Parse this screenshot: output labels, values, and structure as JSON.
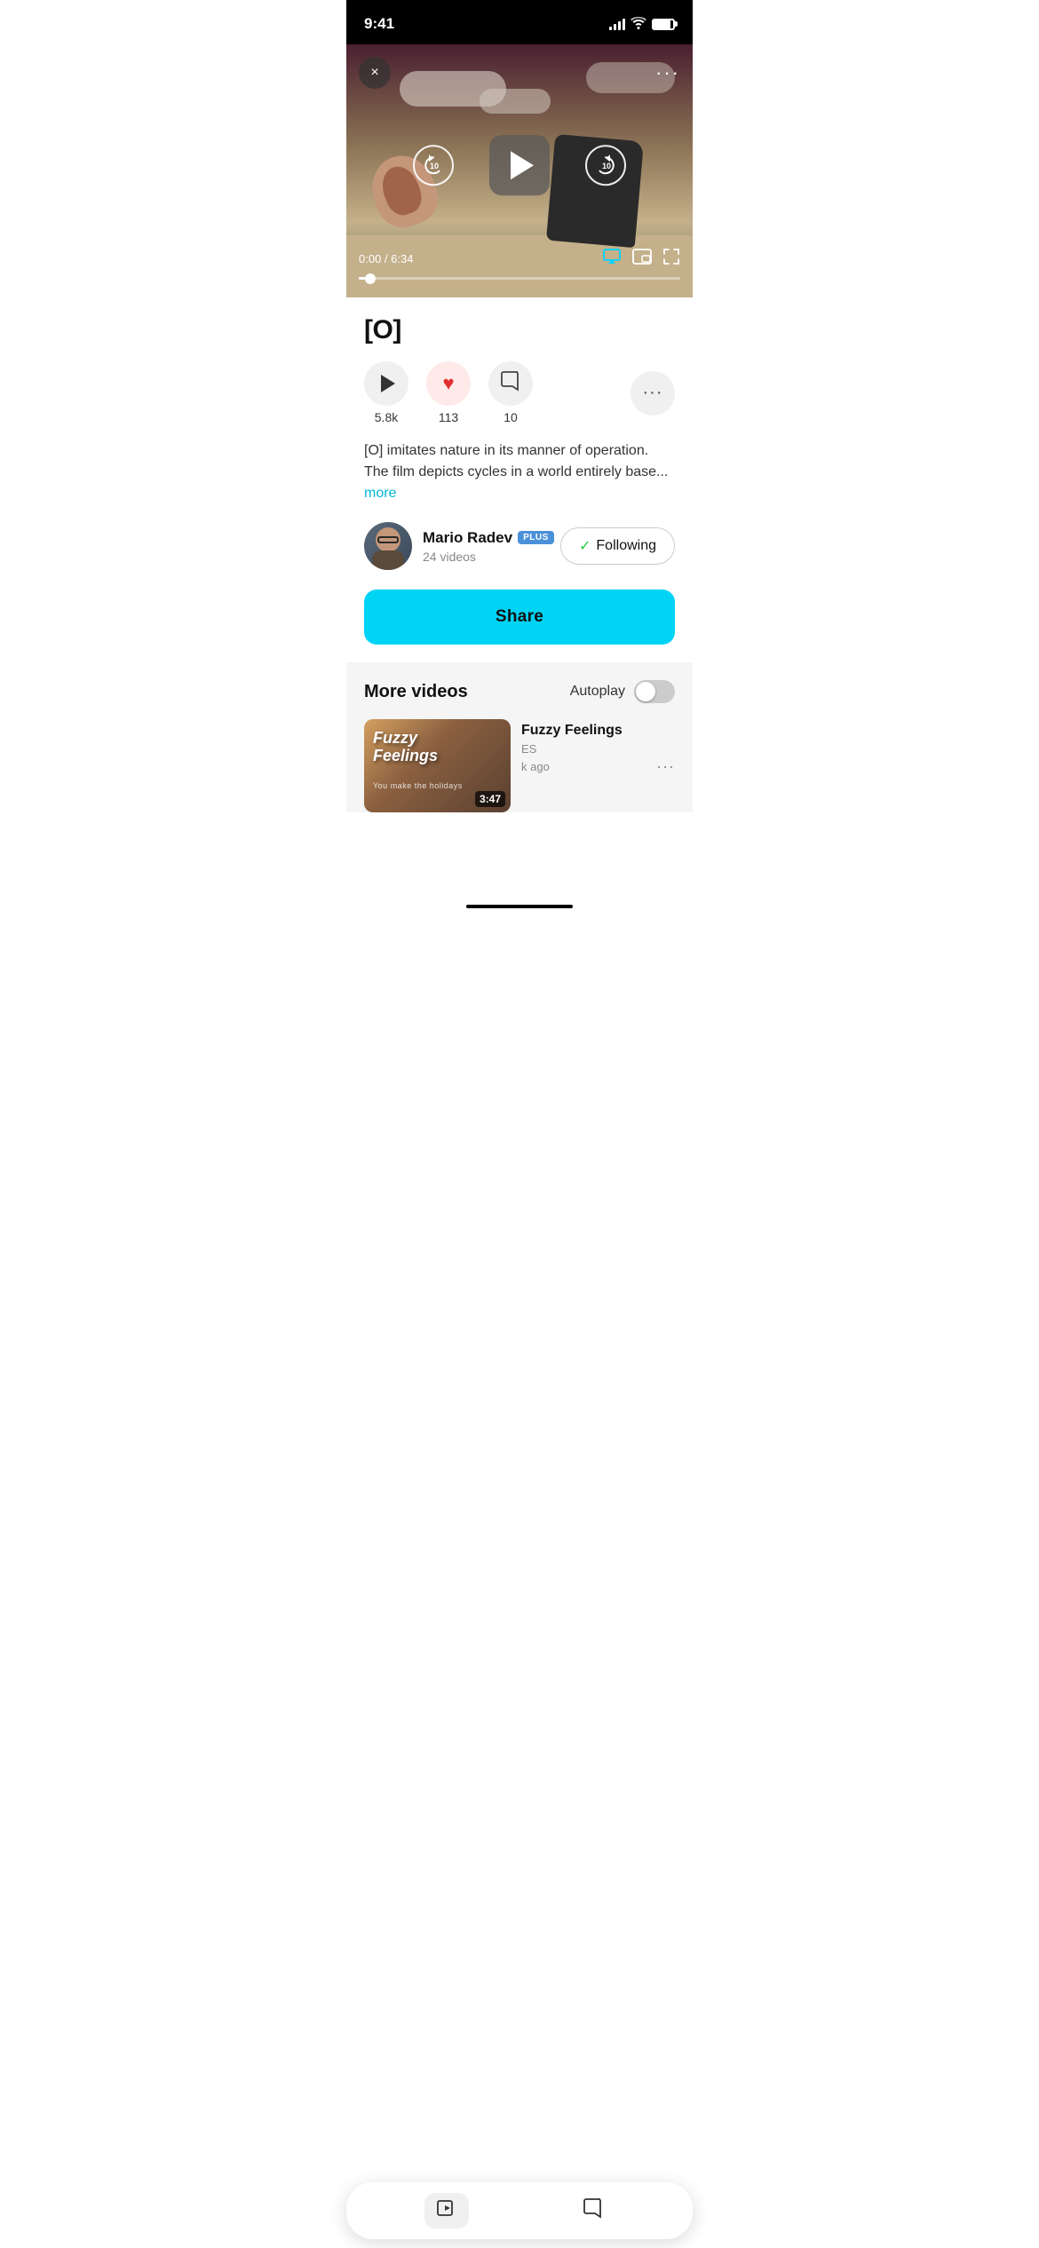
{
  "statusBar": {
    "time": "9:41",
    "signalBars": [
      4,
      7,
      10,
      13
    ],
    "batteryPercent": 85
  },
  "videoPlayer": {
    "currentTime": "0:00",
    "totalTime": "6:34",
    "progressPercent": 2,
    "closeLabel": "×",
    "moreLabel": "···",
    "skip_back": "10",
    "skip_forward": "10"
  },
  "videoInfo": {
    "title": "[O]",
    "plays": "5.8k",
    "likes": "113",
    "comments": "10",
    "description": "[O] imitates nature in its manner of operation. The film depicts cycles in a world entirely base...",
    "moreLabel": "more"
  },
  "creator": {
    "name": "Mario Radev",
    "badge": "PLUS",
    "videoCount": "24 videos",
    "followingLabel": "Following",
    "checkMark": "✓"
  },
  "shareButton": {
    "label": "Share"
  },
  "moreVideos": {
    "sectionTitle": "More videos",
    "autoplayLabel": "Autoplay",
    "autoplayEnabled": false,
    "videos": [
      {
        "title": "Fuzzy Feelings",
        "thumbnail_text": "Fuzzy\nFeelings",
        "subtext": "ES",
        "timeAgo": "k ago",
        "duration": "3:47",
        "more": "···"
      }
    ]
  },
  "bottomBar": {
    "videoIcon": "▶",
    "commentIcon": "💬"
  },
  "homeIndicator": true
}
